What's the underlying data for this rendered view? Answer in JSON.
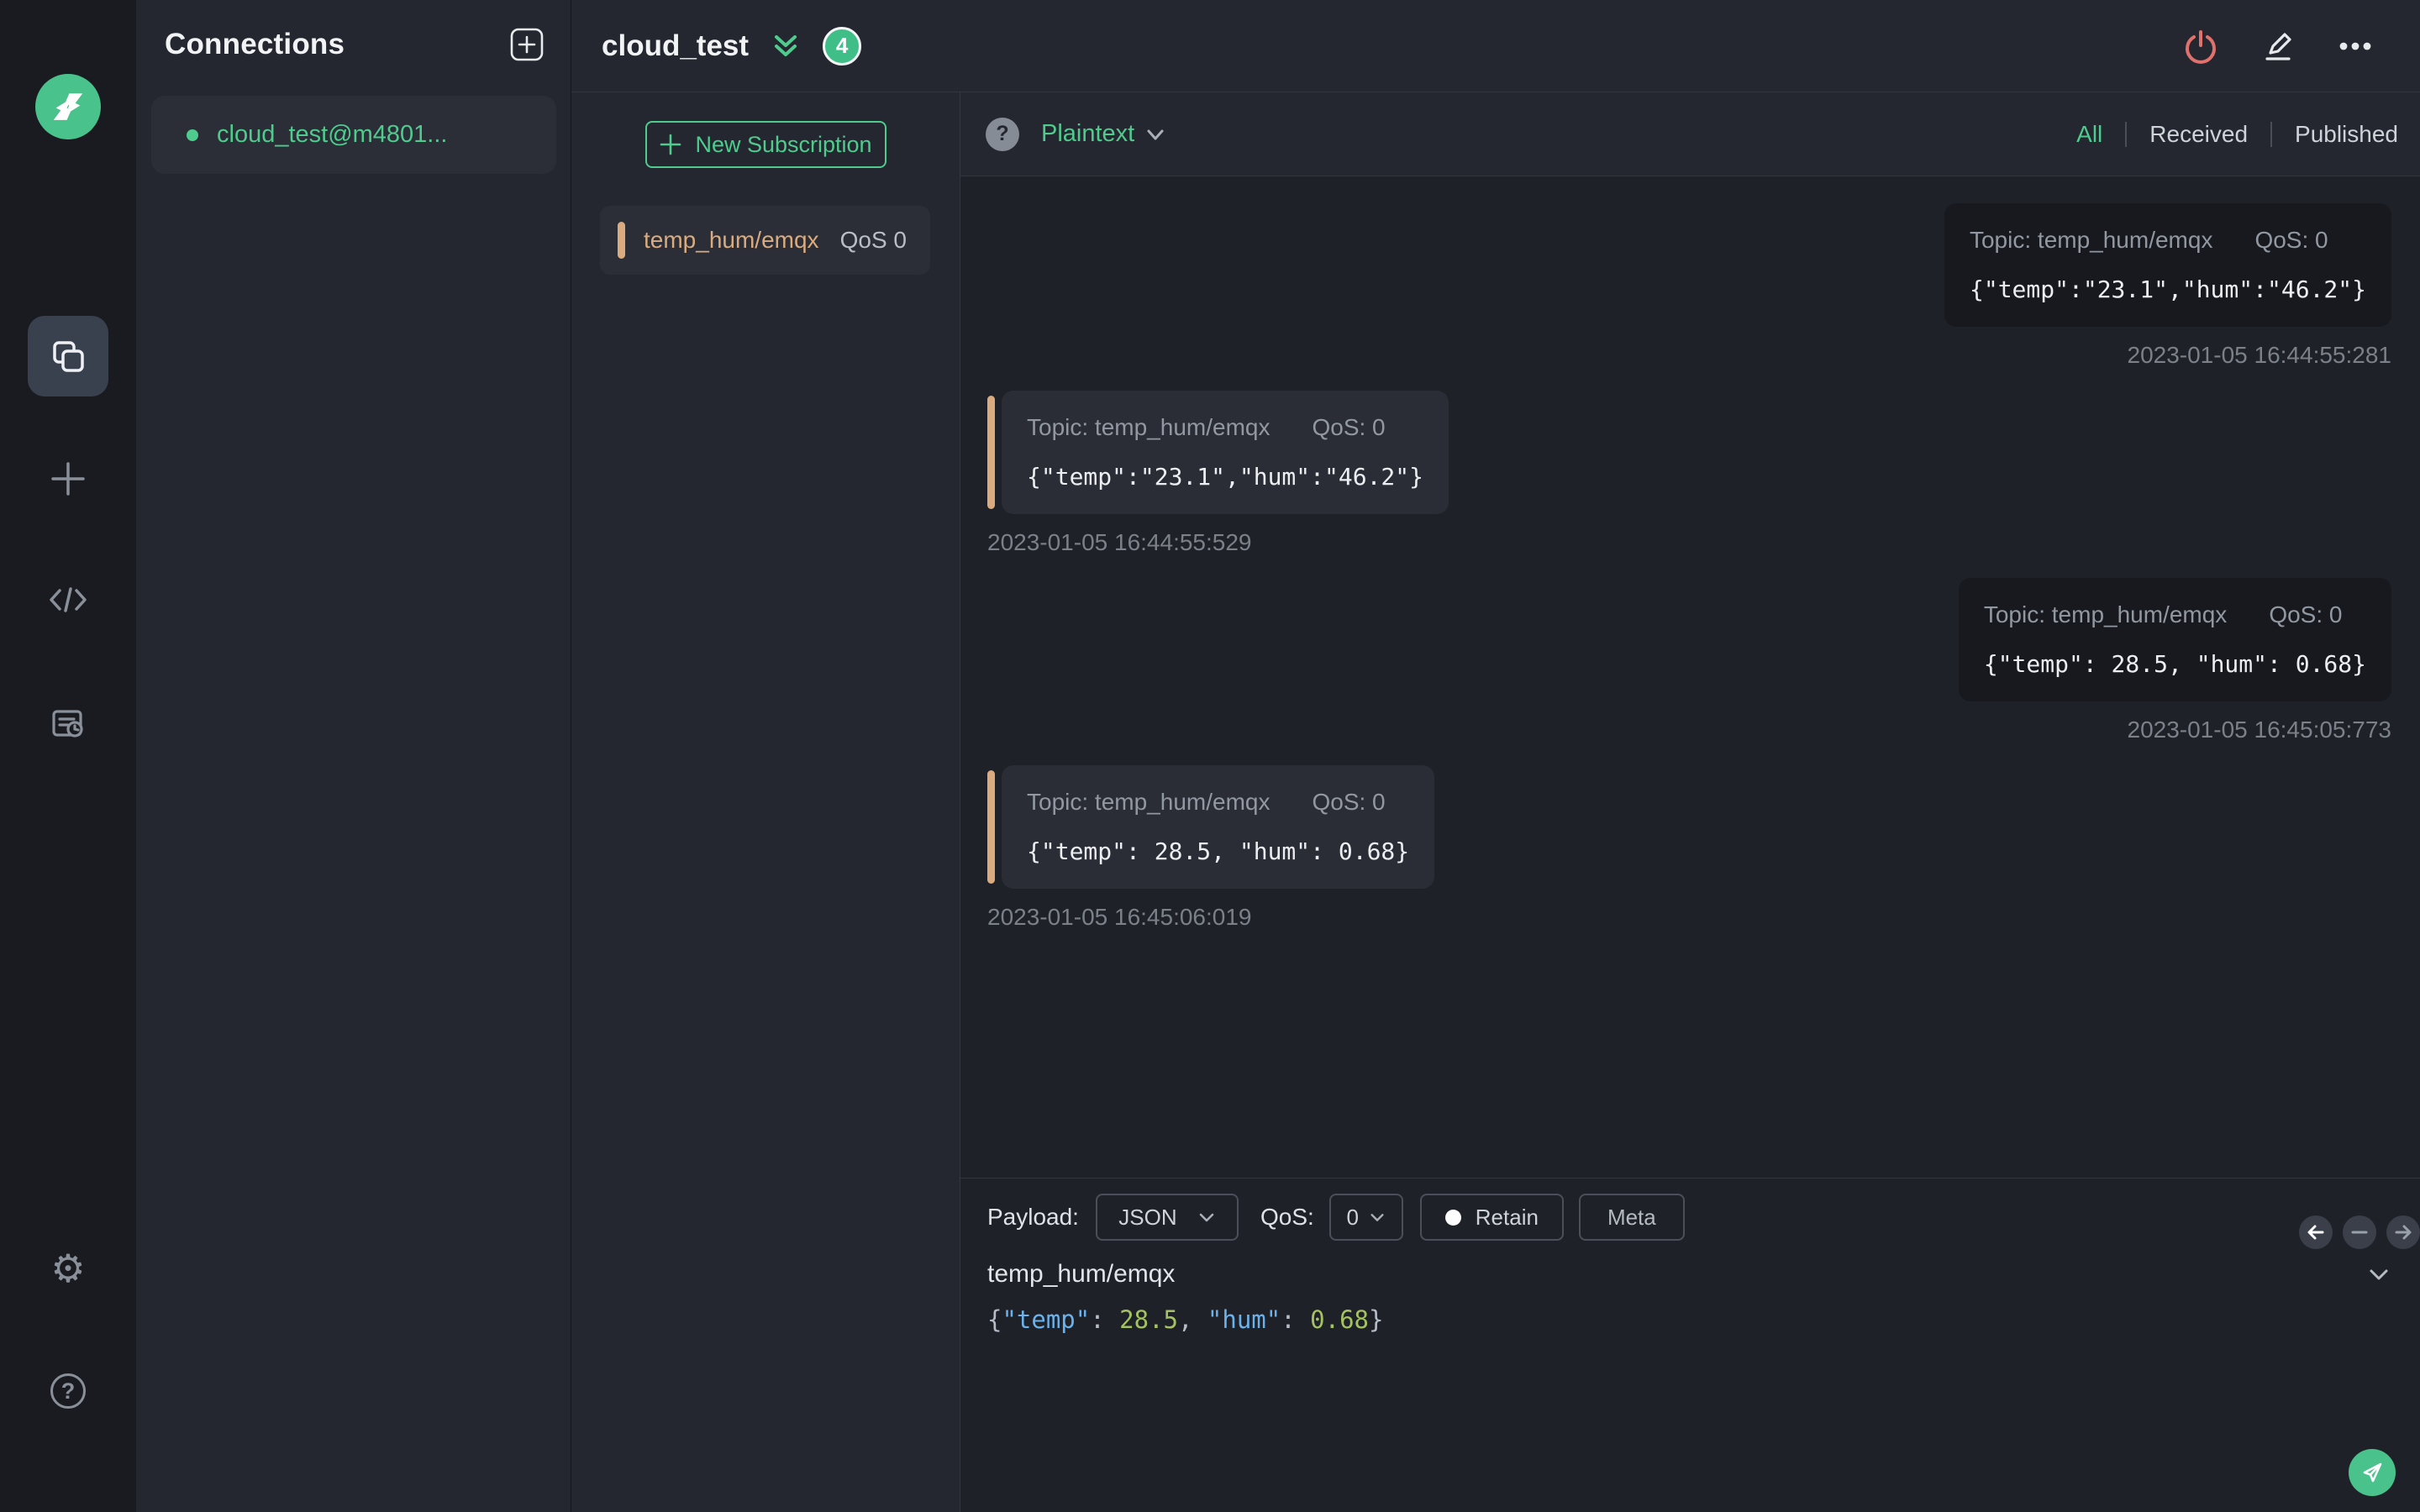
{
  "colors": {
    "accent_green": "#4ecb8d",
    "badge_green": "#3fbe87",
    "logo_green": "#4ac28c",
    "subscription_accent": "#d9ab7e",
    "disconnect_red": "#e0716c",
    "editor_key_blue": "#6cb2ea",
    "editor_number_green": "#a5c261"
  },
  "icons": {
    "gear_glyph": "⚙",
    "help_glyph": "?",
    "mode_help_glyph": "?"
  },
  "connections_panel": {
    "title": "Connections",
    "items": [
      {
        "name": "cloud_test@m4801..."
      }
    ]
  },
  "header": {
    "title": "cloud_test",
    "badge_count": "4"
  },
  "subscriptions": {
    "new_button_label": "New Subscription",
    "items": [
      {
        "topic": "temp_hum/emqx",
        "qos": "QoS 0"
      }
    ]
  },
  "messages_toolbar": {
    "mode": "Plaintext",
    "filters": {
      "all": "All",
      "received": "Received",
      "published": "Published"
    }
  },
  "messages": [
    {
      "side": "right",
      "topic_label": "Topic: temp_hum/emqx",
      "qos_label": "QoS: 0",
      "payload": "{\"temp\":\"23.1\",\"hum\":\"46.2\"}",
      "timestamp": "2023-01-05 16:44:55:281"
    },
    {
      "side": "left",
      "topic_label": "Topic: temp_hum/emqx",
      "qos_label": "QoS: 0",
      "payload": "{\"temp\":\"23.1\",\"hum\":\"46.2\"}",
      "timestamp": "2023-01-05 16:44:55:529"
    },
    {
      "side": "right",
      "topic_label": "Topic: temp_hum/emqx",
      "qos_label": "QoS: 0",
      "payload": "{\"temp\": 28.5, \"hum\": 0.68}",
      "timestamp": "2023-01-05 16:45:05:773"
    },
    {
      "side": "left",
      "topic_label": "Topic: temp_hum/emqx",
      "qos_label": "QoS: 0",
      "payload": "{\"temp\": 28.5, \"hum\": 0.68}",
      "timestamp": "2023-01-05 16:45:06:019"
    }
  ],
  "publish": {
    "payload_label": "Payload:",
    "payload_type": "JSON",
    "qos_label": "QoS:",
    "qos_value": "0",
    "retain_label": "Retain",
    "meta_label": "Meta",
    "topic_value": "temp_hum/emqx",
    "editor": {
      "brace_open": "{",
      "key_temp": "\"temp\"",
      "colon1": ": ",
      "num_temp": "28.5",
      "comma": ", ",
      "key_hum": "\"hum\"",
      "colon2": ": ",
      "num_hum": "0.68",
      "brace_close": "}"
    }
  }
}
